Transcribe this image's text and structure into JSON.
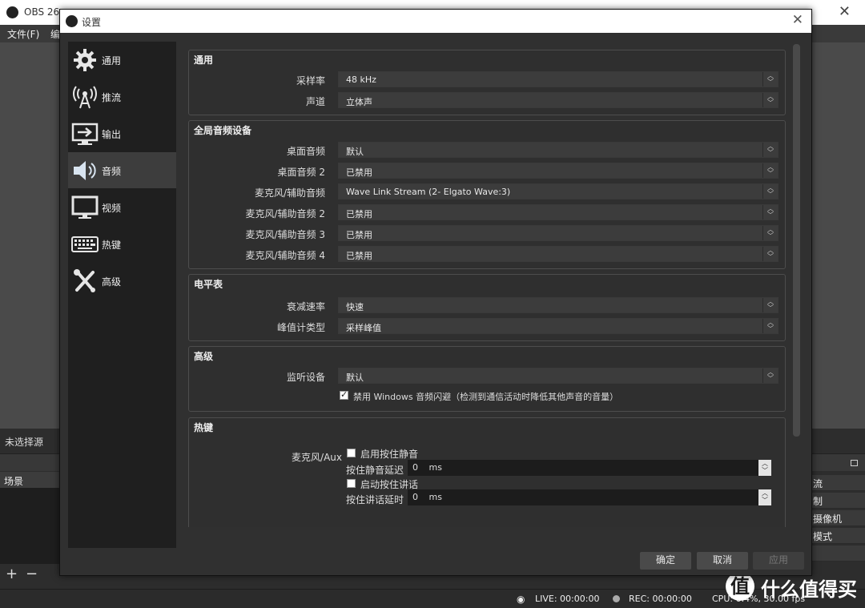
{
  "main_window": {
    "title": "OBS 26.",
    "menu": [
      "文件(F)",
      "编"
    ],
    "no_source_label": "未选择源",
    "scenes_label": "场景",
    "tools": [
      "+",
      "−",
      "∧",
      "∨"
    ],
    "right_panel": [
      "流",
      "制",
      "摄像机",
      "模式",
      ""
    ],
    "status": {
      "live": "LIVE: 00:00:00",
      "rec": "REC: 00:00:00",
      "cpu": "CPU: 0.4%, 30.00 fps"
    }
  },
  "watermark": {
    "circle_char": "值",
    "text": "什么值得买"
  },
  "dialog": {
    "title": "设置",
    "close_glyph": "✕",
    "sidebar": [
      {
        "label": "通用",
        "icon": "gear-icon"
      },
      {
        "label": "推流",
        "icon": "broadcast-icon"
      },
      {
        "label": "输出",
        "icon": "output-icon"
      },
      {
        "label": "音频",
        "icon": "speaker-icon",
        "active": true
      },
      {
        "label": "视频",
        "icon": "monitor-icon"
      },
      {
        "label": "热键",
        "icon": "keyboard-icon"
      },
      {
        "label": "高级",
        "icon": "tools-icon"
      }
    ],
    "general": {
      "title": "通用",
      "sample_rate": {
        "label": "采样率",
        "value": "48 kHz"
      },
      "channels": {
        "label": "声道",
        "value": "立体声"
      }
    },
    "global_audio": {
      "title": "全局音频设备",
      "rows": [
        {
          "label": "桌面音频",
          "value": "默认"
        },
        {
          "label": "桌面音频 2",
          "value": "已禁用"
        },
        {
          "label": "麦克风/辅助音频",
          "value": "Wave Link Stream (2- Elgato Wave:3)"
        },
        {
          "label": "麦克风/辅助音频 2",
          "value": "已禁用"
        },
        {
          "label": "麦克风/辅助音频 3",
          "value": "已禁用"
        },
        {
          "label": "麦克风/辅助音频 4",
          "value": "已禁用"
        }
      ]
    },
    "meters": {
      "title": "电平表",
      "decay": {
        "label": "衰减速率",
        "value": "快速"
      },
      "peak": {
        "label": "峰值计类型",
        "value": "采样峰值"
      }
    },
    "advanced": {
      "title": "高级",
      "monitor": {
        "label": "监听设备",
        "value": "默认"
      },
      "ducking": {
        "label": "禁用 Windows 音频闪避（检测到通信活动时降低其他声音的音量）",
        "checked": true
      }
    },
    "hotkeys": {
      "title": "热键",
      "source_label": "麦克风/Aux",
      "ptm_enable": {
        "label": "启用按住静音",
        "checked": false
      },
      "ptm_delay": {
        "label": "按住静音延迟",
        "value": "0",
        "unit": "ms"
      },
      "ptt_enable": {
        "label": "启动按住讲话",
        "checked": false
      },
      "ptt_delay": {
        "label": "按住讲话延时",
        "value": "0",
        "unit": "ms"
      }
    },
    "buttons": {
      "ok": "确定",
      "cancel": "取消",
      "apply": "应用"
    }
  },
  "colors": {
    "dialog_bg": "#303030",
    "sidebar_bg": "#1f1f1f",
    "active_item": "#3d3d3d",
    "combo_bg": "#3c3c3c"
  }
}
